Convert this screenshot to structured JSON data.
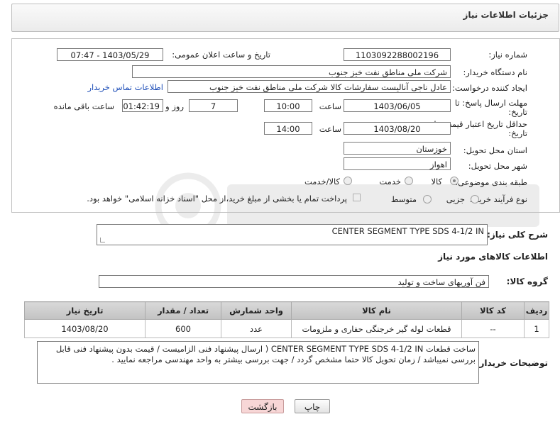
{
  "header": {
    "title": "جزئیات اطلاعات نیاز"
  },
  "form": {
    "need_number_label": "شماره نیاز:",
    "need_number": "1103092288002196",
    "announce_label": "تاریخ و ساعت اعلان عمومی:",
    "announce_value": "1403/05/29 - 07:47",
    "buyer_org_label": "نام دستگاه خریدار:",
    "buyer_org": "شرکت ملی مناطق نفت خیز جنوب",
    "requester_label": "ایجاد کننده درخواست:",
    "requester": "عادل  ناجی آنالیست سفارشات کالا  شرکت ملی مناطق نفت خیز جنوب",
    "buyer_contact_link": "اطلاعات تماس خریدار",
    "deadline_label_1": "مهلت ارسال پاسخ: تا",
    "deadline_label_2": "تاریخ:",
    "deadline_date": "1403/06/05",
    "time_label": "ساعت",
    "deadline_time": "10:00",
    "days_value": "7",
    "days_label": "روز و",
    "remaining_time": "01:42:19",
    "remaining_label": "ساعت باقی مانده",
    "validity_label_1": "حداقل تاریخ اعتبار قیمت: تا",
    "validity_label_2": "تاریخ:",
    "validity_date": "1403/08/20",
    "validity_time": "14:00",
    "province_label": "استان محل تحویل:",
    "province": "خوزستان",
    "city_label": "شهر محل تحویل:",
    "city": "اهواز",
    "category_label": "طبقه بندی موضوعی:",
    "category_goods": "کالا",
    "category_service": "خدمت",
    "category_both": "کالا/خدمت",
    "process_label": "نوع فرآیند خرید :",
    "process_partial": "جزیی",
    "process_medium": "متوسط",
    "payment_note": "پرداخت تمام یا بخشی از مبلغ خرید،از محل \"اسناد خزانه اسلامی\" خواهد بود."
  },
  "general_desc": {
    "label": "شرح کلی نیاز:",
    "value": "CENTER  SEGMENT TYPE SDS  4-1/2 IN"
  },
  "goods_info": {
    "title": "اطلاعات کالاهای مورد نیاز",
    "group_label": "گروه کالا:",
    "group_value": "فن آوریهای ساخت و تولید"
  },
  "table": {
    "headers": [
      "ردیف",
      "کد کالا",
      "نام کالا",
      "واحد شمارش",
      "تعداد / مقدار",
      "تاریخ نیاز"
    ],
    "rows": [
      [
        "1",
        "--",
        "قطعات لوله گیر خرجنگی حفاری و ملزومات",
        "عدد",
        "600",
        "1403/08/20"
      ]
    ]
  },
  "buyer_notes": {
    "label": "توضیحات خریدار:",
    "line1": "ساخت قطعات CENTER  SEGMENT TYPE SDS  4-1/2 IN ( ارسال پیشنهاد فنی الزامیست / قیمت بدون پیشنهاد فنی قابل",
    "line2": "بررسی نمیباشد / زمان تحویل کالا حتما مشخص گردد / جهت بررسی بیشتر به واحد مهندسی مراجعه نمایید ."
  },
  "buttons": {
    "print": "چاپ",
    "back": "بازگشت"
  },
  "colors": {
    "back_button_bg": "#f7d6d6",
    "link": "#1f4fb8"
  }
}
